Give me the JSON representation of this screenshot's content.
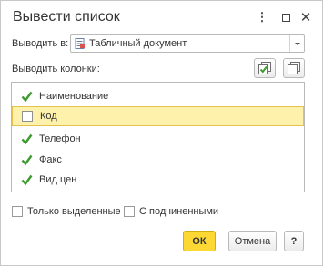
{
  "window": {
    "title": "Вывести список",
    "menu_glyph": "⋮",
    "close_glyph": "✕"
  },
  "output_to": {
    "label": "Выводить в:",
    "value": "Табличный документ",
    "icon": "spreadsheet-icon"
  },
  "columns": {
    "label": "Выводить колонки:",
    "items": [
      {
        "label": "Наименование",
        "checked": true,
        "selected": false
      },
      {
        "label": "Код",
        "checked": false,
        "selected": true
      },
      {
        "label": "Телефон",
        "checked": true,
        "selected": false
      },
      {
        "label": "Факс",
        "checked": true,
        "selected": false
      },
      {
        "label": "Вид цен",
        "checked": true,
        "selected": false
      }
    ]
  },
  "options": {
    "only_selected_label": "Только выделенные",
    "with_children_label": "С подчиненными"
  },
  "buttons": {
    "ok_label": "ОК",
    "cancel_label": "Отмена",
    "help_label": "?"
  },
  "colors": {
    "check_green": "#3c9a2e",
    "ok_yellow": "#fdd835",
    "selected_row": "#fdf1ac"
  }
}
